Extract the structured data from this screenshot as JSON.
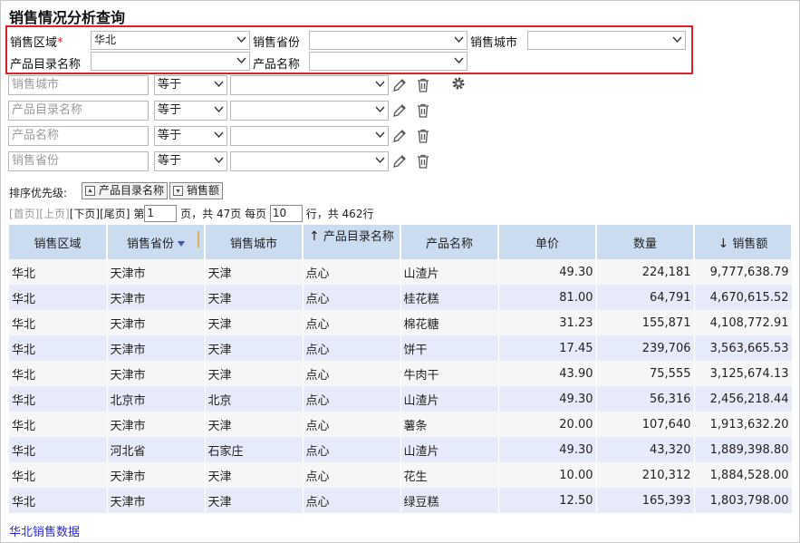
{
  "title": "销售情况分析查询",
  "filters": {
    "region_label": "销售区域",
    "required_mark": "*",
    "region_value": "华北",
    "province_label": "销售省份",
    "province_value": "",
    "city_label": "销售城市",
    "city_value": "",
    "catalog_label": "产品目录名称",
    "catalog_value": "",
    "product_label": "产品名称",
    "product_value": ""
  },
  "conditions": [
    {
      "field": "销售城市",
      "operator": "等于",
      "value": ""
    },
    {
      "field": "产品目录名称",
      "operator": "等于",
      "value": ""
    },
    {
      "field": "产品名称",
      "operator": "等于",
      "value": ""
    },
    {
      "field": "销售省份",
      "operator": "等于",
      "value": ""
    }
  ],
  "sort": {
    "label": "排序优先级:",
    "chips": [
      "产品目录名称",
      "销售额"
    ]
  },
  "pager": {
    "first": "[首页]",
    "prev": "[上页]",
    "next": "[下页]",
    "last": "[尾页]",
    "page_prefix": "第",
    "page_value": "1",
    "total_text": "页，共 47页 每页",
    "per_page_value": "10",
    "rows_text": "行，共 462行"
  },
  "table": {
    "columns": [
      "销售区域",
      "销售省份",
      "销售城市",
      "产品目录名称",
      "产品名称",
      "单价",
      "数量",
      "销售额"
    ],
    "rows": [
      [
        "华北",
        "天津市",
        "天津",
        "点心",
        "山渣片",
        "49.30",
        "224,181",
        "9,777,638.79"
      ],
      [
        "华北",
        "天津市",
        "天津",
        "点心",
        "桂花糕",
        "81.00",
        "64,791",
        "4,670,615.52"
      ],
      [
        "华北",
        "天津市",
        "天津",
        "点心",
        "棉花糖",
        "31.23",
        "155,871",
        "4,108,772.91"
      ],
      [
        "华北",
        "天津市",
        "天津",
        "点心",
        "饼干",
        "17.45",
        "239,706",
        "3,563,665.53"
      ],
      [
        "华北",
        "天津市",
        "天津",
        "点心",
        "牛肉干",
        "43.90",
        "75,555",
        "3,125,674.13"
      ],
      [
        "华北",
        "北京市",
        "北京",
        "点心",
        "山渣片",
        "49.30",
        "56,316",
        "2,456,218.44"
      ],
      [
        "华北",
        "天津市",
        "天津",
        "点心",
        "薯条",
        "20.00",
        "107,640",
        "1,913,632.20"
      ],
      [
        "华北",
        "河北省",
        "石家庄",
        "点心",
        "山渣片",
        "49.30",
        "43,320",
        "1,889,398.80"
      ],
      [
        "华北",
        "天津市",
        "天津",
        "点心",
        "花生",
        "10.00",
        "210,312",
        "1,884,528.00"
      ],
      [
        "华北",
        "天津市",
        "天津",
        "点心",
        "绿豆糕",
        "12.50",
        "165,393",
        "1,803,798.00"
      ]
    ]
  },
  "footer_link": "华北销售数据",
  "colors": {
    "header_bg": "#ccdcf0",
    "row_alt_bg": "#e6eaf9",
    "highlight_border": "#e0202a",
    "link": "#2a2ad0"
  }
}
